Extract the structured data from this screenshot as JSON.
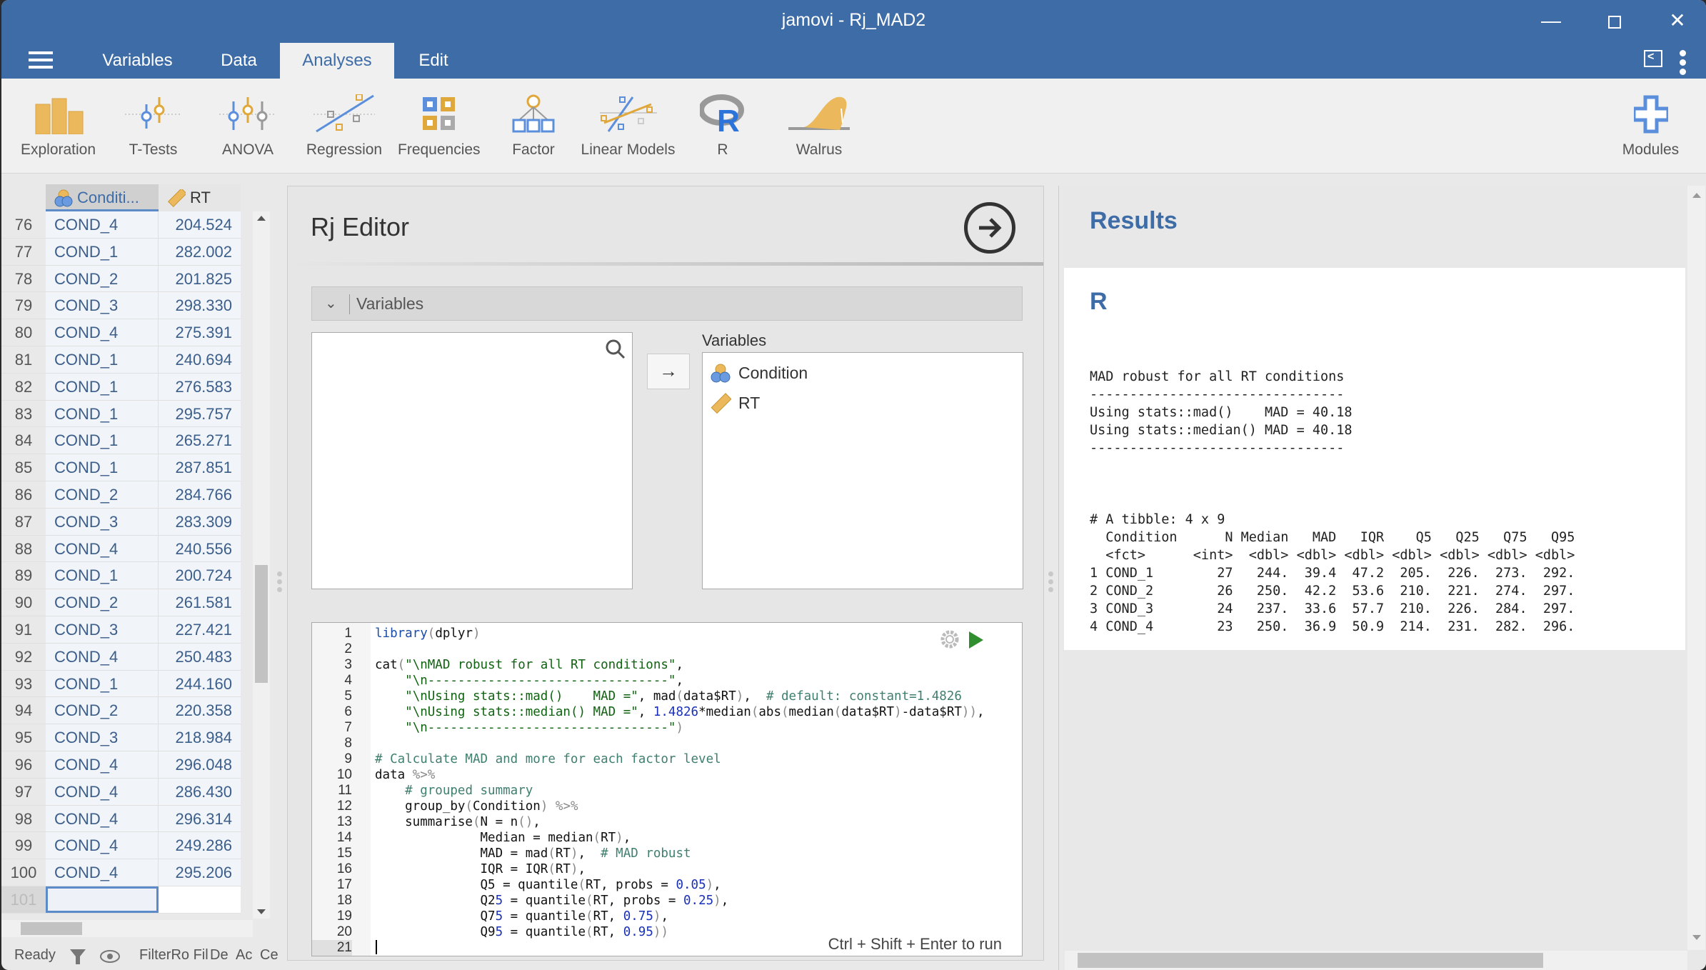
{
  "window": {
    "title": "jamovi - Rj_MAD2",
    "controls": {
      "minimize": "—",
      "maximize": "",
      "close": "✕"
    }
  },
  "menu": {
    "tabs": [
      {
        "label": "Variables",
        "active": false
      },
      {
        "label": "Data",
        "active": false
      },
      {
        "label": "Analyses",
        "active": true
      },
      {
        "label": "Edit",
        "active": false
      }
    ]
  },
  "ribbon": {
    "items": [
      {
        "label": "Exploration",
        "icon": "exploration-icon"
      },
      {
        "label": "T-Tests",
        "icon": "t-tests-icon"
      },
      {
        "label": "ANOVA",
        "icon": "anova-icon"
      },
      {
        "label": "Regression",
        "icon": "regression-icon"
      },
      {
        "label": "Frequencies",
        "icon": "frequencies-icon"
      },
      {
        "label": "Factor",
        "icon": "factor-icon"
      },
      {
        "label": "Linear Models",
        "icon": "linear-models-icon"
      },
      {
        "label": "R",
        "icon": "r-icon"
      },
      {
        "label": "Walrus",
        "icon": "walrus-icon"
      }
    ],
    "modules_label": "Modules"
  },
  "grid": {
    "columns": [
      {
        "name": "Conditi...",
        "type": "nominal"
      },
      {
        "name": "RT",
        "type": "continuous"
      }
    ],
    "rows": [
      {
        "n": "76",
        "cond": "COND_4",
        "rt": "204.524"
      },
      {
        "n": "77",
        "cond": "COND_1",
        "rt": "282.002"
      },
      {
        "n": "78",
        "cond": "COND_2",
        "rt": "201.825"
      },
      {
        "n": "79",
        "cond": "COND_3",
        "rt": "298.330"
      },
      {
        "n": "80",
        "cond": "COND_4",
        "rt": "275.391"
      },
      {
        "n": "81",
        "cond": "COND_1",
        "rt": "240.694"
      },
      {
        "n": "82",
        "cond": "COND_1",
        "rt": "276.583"
      },
      {
        "n": "83",
        "cond": "COND_1",
        "rt": "295.757"
      },
      {
        "n": "84",
        "cond": "COND_1",
        "rt": "265.271"
      },
      {
        "n": "85",
        "cond": "COND_1",
        "rt": "287.851"
      },
      {
        "n": "86",
        "cond": "COND_2",
        "rt": "284.766"
      },
      {
        "n": "87",
        "cond": "COND_3",
        "rt": "283.309"
      },
      {
        "n": "88",
        "cond": "COND_4",
        "rt": "240.556"
      },
      {
        "n": "89",
        "cond": "COND_1",
        "rt": "200.724"
      },
      {
        "n": "90",
        "cond": "COND_2",
        "rt": "261.581"
      },
      {
        "n": "91",
        "cond": "COND_3",
        "rt": "227.421"
      },
      {
        "n": "92",
        "cond": "COND_4",
        "rt": "250.483"
      },
      {
        "n": "93",
        "cond": "COND_1",
        "rt": "244.160"
      },
      {
        "n": "94",
        "cond": "COND_2",
        "rt": "220.358"
      },
      {
        "n": "95",
        "cond": "COND_3",
        "rt": "218.984"
      },
      {
        "n": "96",
        "cond": "COND_4",
        "rt": "296.048"
      },
      {
        "n": "97",
        "cond": "COND_4",
        "rt": "286.430"
      },
      {
        "n": "98",
        "cond": "COND_4",
        "rt": "296.314"
      },
      {
        "n": "99",
        "cond": "COND_4",
        "rt": "249.286"
      },
      {
        "n": "100",
        "cond": "COND_4",
        "rt": "295.206"
      },
      {
        "n": "101",
        "cond": "",
        "rt": ""
      }
    ]
  },
  "status": {
    "ready": "Ready",
    "filter_text": "FilterRo Fil",
    "items": [
      "De",
      "Ac",
      "Ce"
    ]
  },
  "editor": {
    "title": "Rj Editor",
    "collapse_label": "Variables",
    "target_label": "Variables",
    "target_vars": [
      {
        "name": "Condition",
        "type": "nominal"
      },
      {
        "name": "RT",
        "type": "continuous"
      }
    ],
    "move_arrow": "→",
    "run_hint": "Ctrl + Shift + Enter to run",
    "code_lines": [
      "library(dplyr)",
      "",
      "cat(\"\\nMAD robust for all RT conditions\",",
      "    \"\\n--------------------------------\",",
      "    \"\\nUsing stats::mad()    MAD =\", mad(data$RT),  # default: constant=1.4826",
      "    \"\\nUsing stats::median() MAD =\", 1.4826*median(abs(median(data$RT)-data$RT)),",
      "    \"\\n--------------------------------\")",
      "",
      "# Calculate MAD and more for each factor level",
      "data %>%",
      "    # grouped summary",
      "    group_by(Condition) %>%",
      "    summarise(N = n(),",
      "              Median = median(RT),",
      "              MAD = mad(RT),  # MAD robust",
      "              IQR = IQR(RT),",
      "              Q5 = quantile(RT, probs = 0.05),",
      "              Q25 = quantile(RT, probs = 0.25),",
      "              Q75 = quantile(RT, 0.75),",
      "              Q95 = quantile(RT, 0.95))",
      ""
    ]
  },
  "results": {
    "title": "Results",
    "section": "R",
    "summary_lines": [
      "MAD robust for all RT conditions",
      "--------------------------------",
      "Using stats::mad()    MAD = 40.18",
      "Using stats::median() MAD = 40.18",
      "--------------------------------"
    ],
    "tibble_header": "# A tibble: 4 x 9",
    "tibble_columns": [
      "Condition",
      "N",
      "Median",
      "MAD",
      "IQR",
      "Q5",
      "Q25",
      "Q75",
      "Q95"
    ],
    "tibble_types": [
      "<fct>",
      "<int>",
      "<dbl>",
      "<dbl>",
      "<dbl>",
      "<dbl>",
      "<dbl>",
      "<dbl>",
      "<dbl>"
    ],
    "tibble_rows": [
      [
        "1",
        "COND_1",
        "27",
        "244.",
        "39.4",
        "47.2",
        "205.",
        "226.",
        "273.",
        "292."
      ],
      [
        "2",
        "COND_2",
        "26",
        "250.",
        "42.2",
        "53.6",
        "210.",
        "221.",
        "274.",
        "297."
      ],
      [
        "3",
        "COND_3",
        "24",
        "237.",
        "33.6",
        "57.7",
        "210.",
        "226.",
        "284.",
        "297."
      ],
      [
        "4",
        "COND_4",
        "23",
        "250.",
        "36.9",
        "50.9",
        "214.",
        "231.",
        "282.",
        "296."
      ]
    ]
  },
  "colors": {
    "brand": "#3e6ca7",
    "nominal_icon": "#6a9be0",
    "continuous_icon": "#e8b04a",
    "run_green": "#2f8f2f"
  }
}
